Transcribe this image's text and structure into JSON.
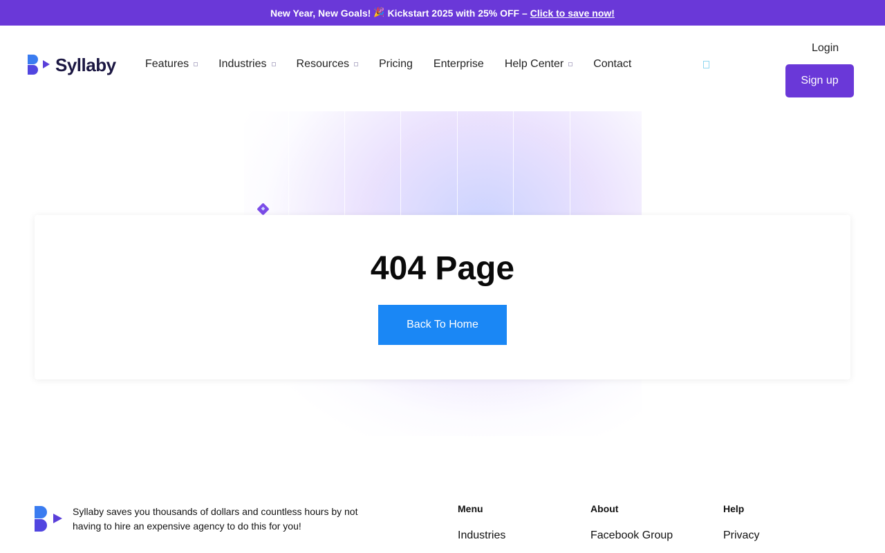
{
  "promo": {
    "text_before": "New Year, New Goals!",
    "emoji": "🎉",
    "text_after": "Kickstart 2025 with 25% OFF –",
    "link": "Click to save now!"
  },
  "header": {
    "logo_text": "Syllaby",
    "nav": [
      {
        "label": "Features",
        "dropdown": true
      },
      {
        "label": "Industries",
        "dropdown": true
      },
      {
        "label": "Resources",
        "dropdown": true
      },
      {
        "label": "Pricing",
        "dropdown": false
      },
      {
        "label": "Enterprise",
        "dropdown": false
      },
      {
        "label": "Help Center",
        "dropdown": true
      },
      {
        "label": "Contact",
        "dropdown": false
      }
    ],
    "login": "Login",
    "signup": "Sign up"
  },
  "main": {
    "title": "404 Page",
    "back_button": "Back To Home"
  },
  "footer": {
    "description": "Syllaby saves you thousands of dollars and countless hours by not having to hire an expensive agency to do this for you!",
    "columns": [
      {
        "heading": "Menu",
        "first_link": "Industries"
      },
      {
        "heading": "About",
        "first_link": "Facebook Group"
      },
      {
        "heading": "Help",
        "first_link": "Privacy"
      }
    ]
  },
  "colors": {
    "brand_purple": "#6a38d8",
    "button_blue": "#1a87f5",
    "logo_dark": "#1b1742"
  }
}
